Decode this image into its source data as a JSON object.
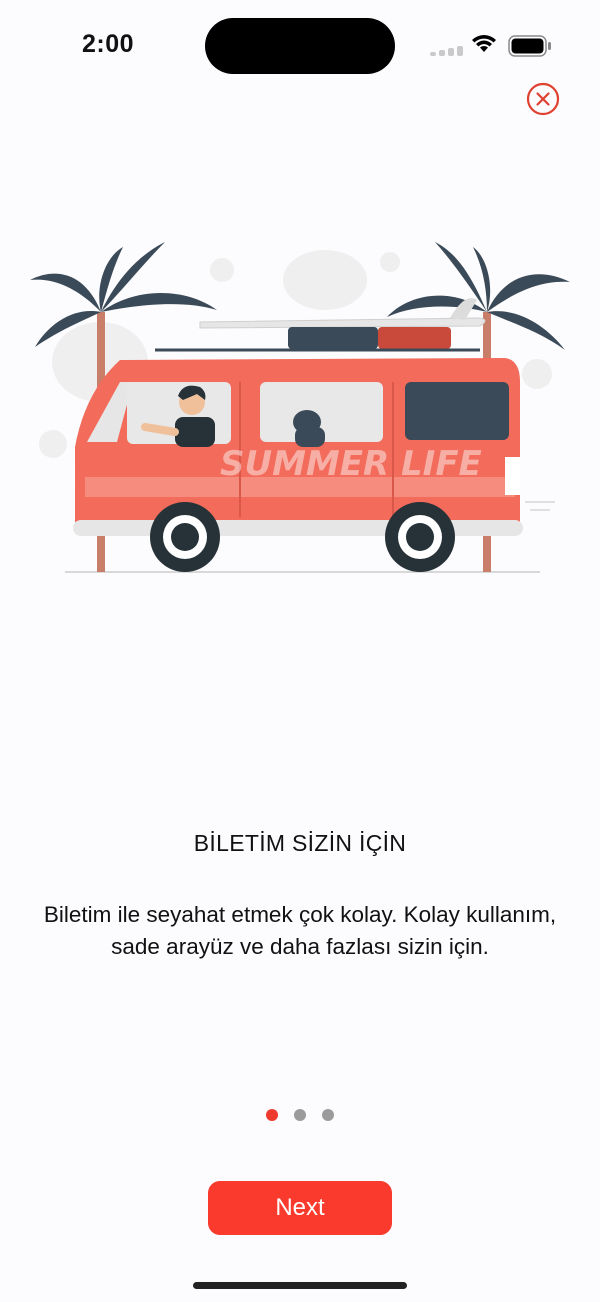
{
  "status_bar": {
    "time": "2:00"
  },
  "onboarding": {
    "title": "BİLETİM SİZİN İÇİN",
    "description": "Biletim ile seyahat etmek çok kolay. Kolay kullanım, sade arayüz ve daha fazlası sizin için.",
    "illustration_text": "SUMMER LIFE",
    "pages": 3,
    "current_page": 1,
    "next_label": "Next"
  },
  "colors": {
    "accent": "#fa3a2c",
    "dot_active": "#ee3b2d",
    "dot_inactive": "#9b9b9b",
    "van": "#f26b5b",
    "palm": "#3b4a58"
  },
  "icons": [
    "close-icon",
    "wifi-icon",
    "battery-icon",
    "signal-icon"
  ]
}
